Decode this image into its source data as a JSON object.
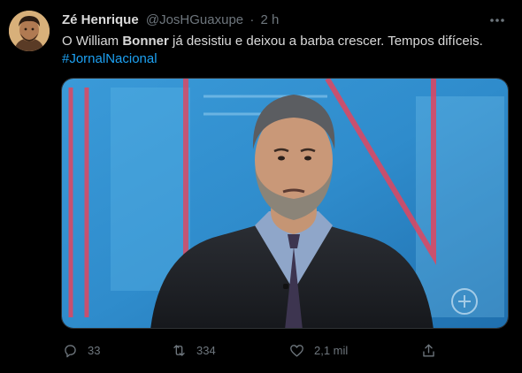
{
  "tweet": {
    "author_name": "Zé Henrique",
    "author_handle": "@JosHGuaxupe",
    "separator": "·",
    "time": "2 h",
    "text_before": "O William ",
    "text_bold": "Bonner",
    "text_after": " já desistiu e deixou a barba crescer. Tempos difíceis.",
    "hashtag": "#JornalNacional",
    "media_icon": "more-icon"
  },
  "actions": {
    "reply_count": "33",
    "retweet_count": "334",
    "like_count": "2,1 mil"
  },
  "colors": {
    "background": "#000000",
    "text": "#d9d9d9",
    "secondary": "#6e767d",
    "link": "#1da1f2",
    "studio_blue": "#2e86c8",
    "studio_red": "#e2455e"
  }
}
